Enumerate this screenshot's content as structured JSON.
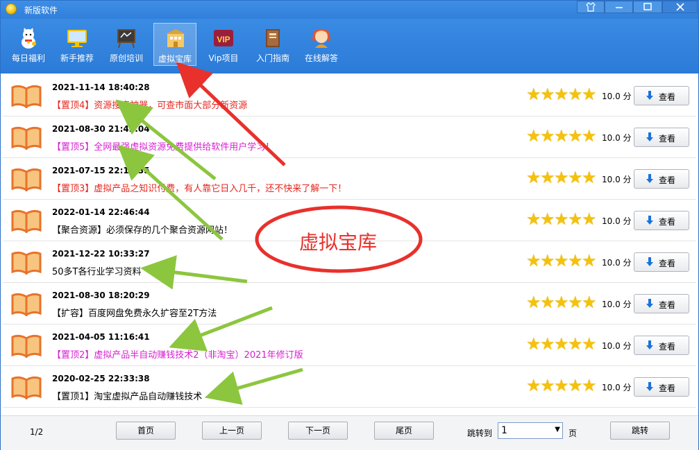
{
  "window": {
    "title": "新版软件"
  },
  "window_buttons": [
    {
      "name": "skin-button",
      "glyph": "👕"
    },
    {
      "name": "minimize-button",
      "glyph": "—"
    },
    {
      "name": "maximize-button",
      "glyph": "▢"
    },
    {
      "name": "close-button",
      "glyph": "✕"
    }
  ],
  "toolbar": {
    "items": [
      {
        "label": "每日福利",
        "icon": "lucky-cat-icon"
      },
      {
        "label": "新手推荐",
        "icon": "monitor-icon"
      },
      {
        "label": "原创培训",
        "icon": "chalkboard-icon"
      },
      {
        "label": "虚拟宝库",
        "icon": "treasure-building-icon",
        "active": true
      },
      {
        "label": "Vip项目",
        "icon": "vip-icon"
      },
      {
        "label": "入门指南",
        "icon": "guide-book-icon"
      },
      {
        "label": "在线解答",
        "icon": "support-agent-icon"
      }
    ]
  },
  "list": {
    "items": [
      {
        "date": "2021-11-14 18:40:28",
        "title": "【置顶4】资源搜索神器，可查市面大部分新资源",
        "color": "#e5261e",
        "score": "10.0 分",
        "view": "查看"
      },
      {
        "date": "2021-08-30 21:42:04",
        "title": "【置顶5】全网最强虚拟资源免费提供给软件用户学习！",
        "color": "#d61ed0",
        "score": "10.0 分",
        "view": "查看"
      },
      {
        "date": "2021-07-15 22:14:35",
        "title": "【置顶3】虚拟产品之知识付费，有人靠它日入几千，还不快来了解一下！",
        "color": "#e5261e",
        "score": "10.0 分",
        "view": "查看"
      },
      {
        "date": "2022-01-14 22:46:44",
        "title": "【聚合资源】必须保存的几个聚合资源网站！",
        "color": "#000000",
        "score": "10.0 分",
        "view": "查看"
      },
      {
        "date": "2021-12-22 10:33:27",
        "title": "50多T各行业学习资料",
        "color": "#000000",
        "score": "10.0 分",
        "view": "查看"
      },
      {
        "date": "2021-08-30 18:20:29",
        "title": "【扩容】百度网盘免费永久扩容至2T方法",
        "color": "#000000",
        "score": "10.0 分",
        "view": "查看"
      },
      {
        "date": "2021-04-05 11:16:41",
        "title": "【置顶2】虚拟产品半自动赚钱技术2（非淘宝）2021年修订版",
        "color": "#d61ed0",
        "score": "10.0 分",
        "view": "查看"
      },
      {
        "date": "2020-02-25 22:33:38",
        "title": "【置顶1】淘宝虚拟产品自动赚钱技术",
        "color": "#000000",
        "score": "10.0 分",
        "view": "查看"
      }
    ],
    "stars": 5,
    "star_color": "#f4c20d"
  },
  "footer": {
    "page_info": "1/2",
    "first": "首页",
    "prev": "上一页",
    "next": "下一页",
    "last": "尾页",
    "jump_label": "跳转到",
    "jump_value": "1",
    "page_unit": "页",
    "jump_button": "跳转"
  },
  "annotation": {
    "text": "虚拟宝库",
    "color": "#e8312c",
    "arrow_color": "#8cc63f"
  },
  "colors": {
    "titlebar": "#2f7fdc",
    "accent_blue": "#1a73d9"
  }
}
